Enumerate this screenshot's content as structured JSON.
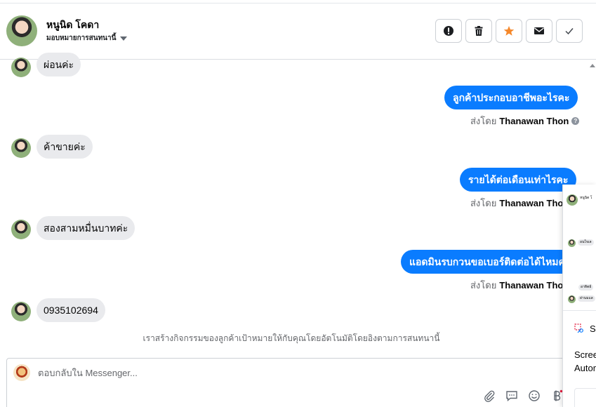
{
  "header": {
    "contact_name": "หนูนิด โคดา",
    "assign_label": "มอบหมายการสนทนานี้",
    "actions": [
      {
        "name": "report-button",
        "icon": "alert-circle-icon"
      },
      {
        "name": "delete-button",
        "icon": "trash-icon"
      },
      {
        "name": "star-button",
        "icon": "star-icon"
      },
      {
        "name": "mark-unread-button",
        "icon": "envelope-icon"
      },
      {
        "name": "mark-done-button",
        "icon": "check-icon"
      }
    ]
  },
  "messages": [
    {
      "direction": "in",
      "text": "ผ่อนค่ะ"
    },
    {
      "direction": "out",
      "text": "ลูกค้าประกอบอาชีพอะไรคะ",
      "sent_by_prefix": "ส่งโดย",
      "sent_by_name": "Thanawan Thon"
    },
    {
      "direction": "in",
      "text": "ค้าขายค่ะ"
    },
    {
      "direction": "out",
      "text": "รายได้ต่อเดือนเท่าไรคะ",
      "sent_by_prefix": "ส่งโดย",
      "sent_by_name": "Thanawan Thon"
    },
    {
      "direction": "in",
      "text": "สองสามหมื่นบาทค่ะ"
    },
    {
      "direction": "out",
      "text": "แอดมินรบกวนขอเบอร์ติดต่อได้ไหมคะ",
      "sent_by_prefix": "ส่งโดย",
      "sent_by_name": "Thanawan Thon"
    },
    {
      "direction": "in",
      "text": "0935102694"
    }
  ],
  "activity_note": "เราสร้างกิจกรรมของลูกค้าเป้าหมายให้กับคุณโดยอัตโนมัติโดยอิงตามการสนทนานี้",
  "composer": {
    "placeholder": "ตอบกลับใน Messenger..."
  },
  "overlay": {
    "thumb_name": "หนูนิด โ",
    "thumb_chip_1": "อนใจเล",
    "thumb_chip_2": "อาทิตย์",
    "thumb_chip_3": "ผ่านมแล",
    "title": "Sc",
    "line1": "Scree",
    "line2": "Autom"
  },
  "colors": {
    "outgoing_bubble": "#0a7cff",
    "incoming_bubble": "#e9eaed",
    "star_accent": "#f5882b"
  }
}
